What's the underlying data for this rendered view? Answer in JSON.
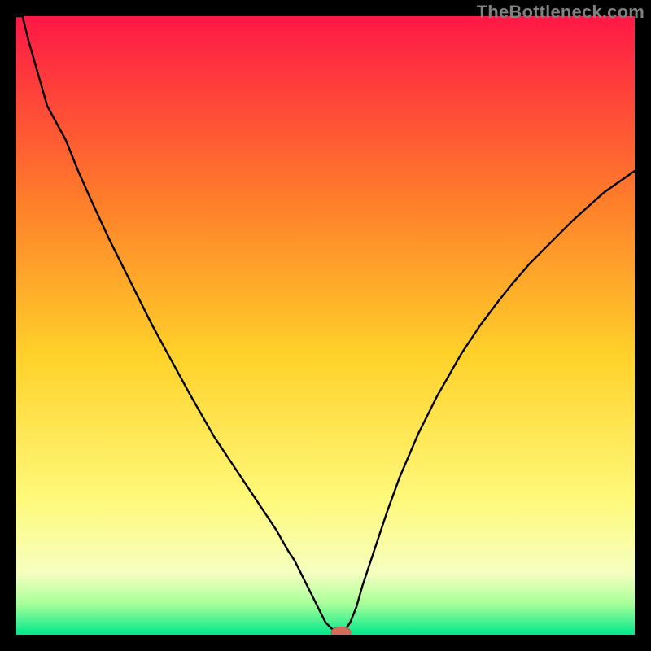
{
  "watermark": "TheBottleneck.com",
  "colors": {
    "gradient_top": "#ff1846",
    "gradient_mid_upper": "#ff7e2a",
    "gradient_mid": "#ffd22a",
    "gradient_mid_lower": "#fff97a",
    "gradient_lower": "#f6ffc0",
    "gradient_green1": "#a8ff9a",
    "gradient_green2": "#00e88b",
    "curve": "#000000",
    "marker": "#d46a5a"
  },
  "chart_data": {
    "type": "line",
    "title": "",
    "xlabel": "",
    "ylabel": "",
    "xlim": [
      0,
      100
    ],
    "ylim": [
      0,
      100
    ],
    "x": [
      0,
      1,
      2,
      3,
      4,
      5,
      8,
      10,
      12,
      15,
      18,
      20,
      22,
      25,
      28,
      30,
      32,
      35,
      38,
      40,
      42,
      44,
      45,
      46,
      47,
      48,
      49,
      50,
      51,
      52,
      52.5,
      53,
      54,
      55,
      56,
      58,
      60,
      62,
      65,
      68,
      70,
      72,
      75,
      78,
      80,
      83,
      86,
      90,
      95,
      100
    ],
    "values": [
      120,
      100,
      96,
      92.5,
      89,
      85.5,
      80,
      75,
      70.5,
      64,
      58,
      54,
      50,
      44.5,
      39,
      35.5,
      32,
      27.5,
      23,
      20,
      17,
      13.5,
      12,
      10,
      8,
      6,
      4,
      2,
      1,
      0.2,
      0,
      0.5,
      2,
      4.5,
      8,
      14,
      20,
      25.5,
      32.5,
      38.5,
      42,
      45.5,
      50,
      54,
      56.5,
      60,
      63,
      67,
      71.5,
      75
    ],
    "minimum_x": 52.5,
    "marker": {
      "x": 52.5,
      "y": 0,
      "rx": 1.6,
      "ry": 0.9
    }
  }
}
